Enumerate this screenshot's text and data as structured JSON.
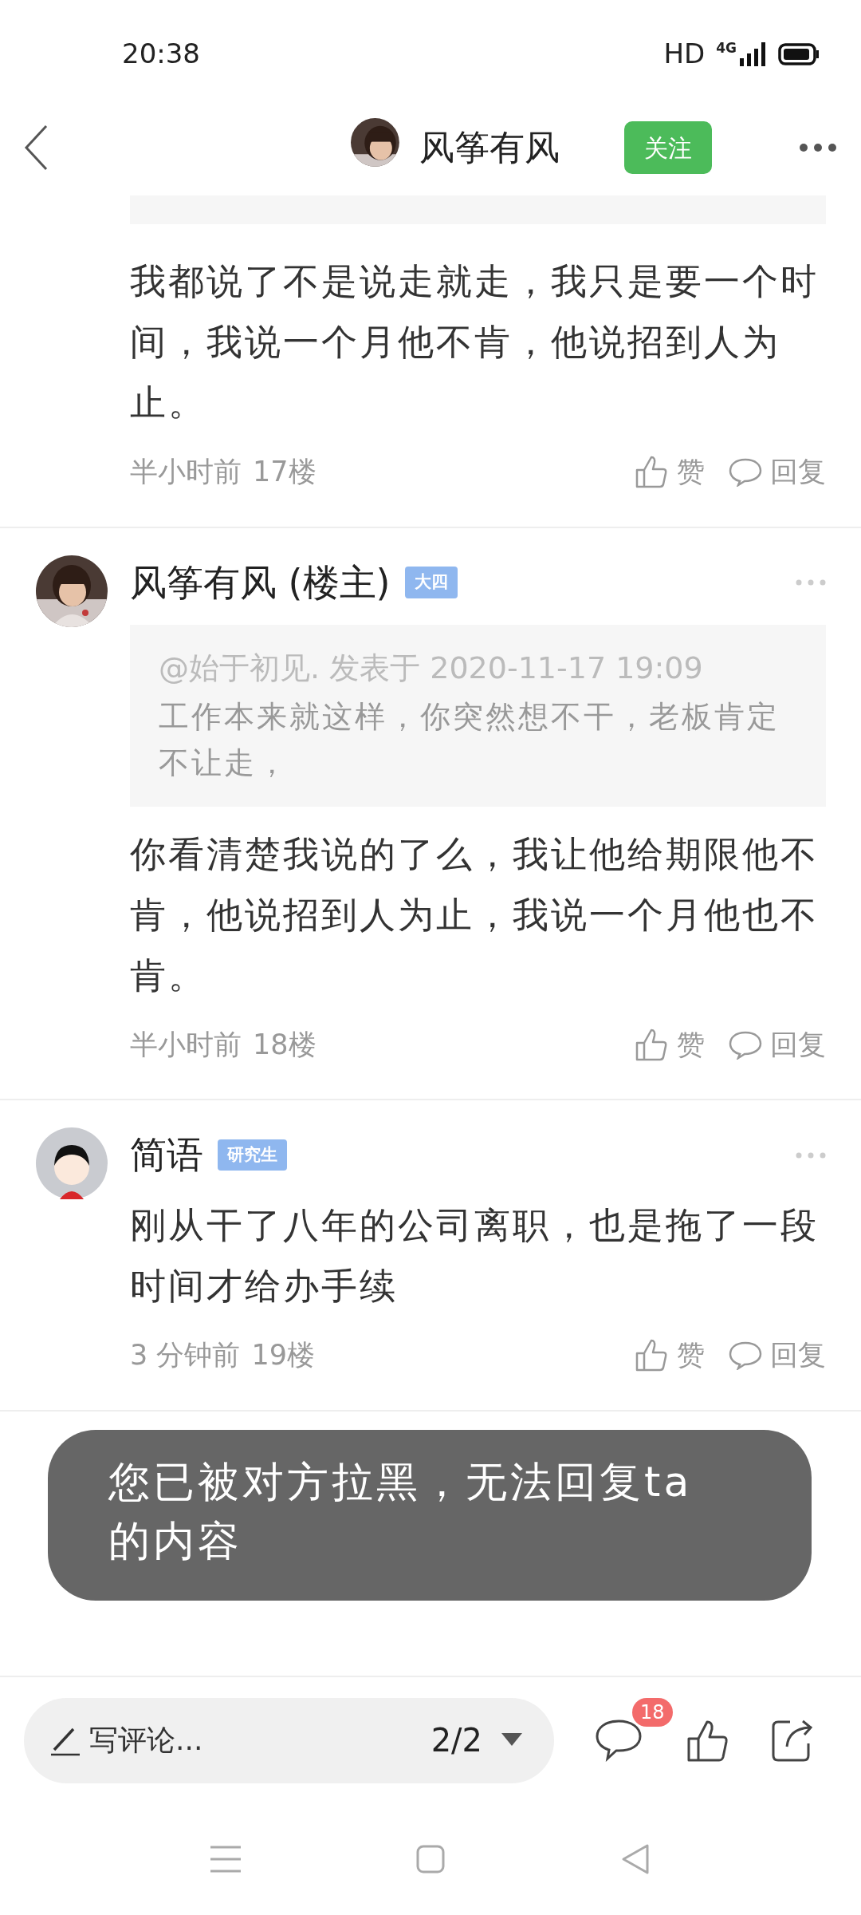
{
  "status_bar": {
    "time": "20:38",
    "hd": "HD",
    "network": "4G"
  },
  "header": {
    "title": "风筝有风",
    "follow_button": "关注"
  },
  "posts": [
    {
      "quote_cut_off": true,
      "body": "我都说了不是说走就走，我只是要一个时间，我说一个月他不肯，他说招到人为止。",
      "time": "半小时前",
      "floor": "17楼",
      "like": "赞",
      "reply": "回复"
    },
    {
      "author": {
        "name": "风筝有风 (楼主)"
      },
      "badge": "大四",
      "quote": {
        "mention": "@始于初见. 发表于 2020-11-17 19:09",
        "text": "工作本来就这样，你突然想不干，老板肯定不让走，"
      },
      "body": "你看清楚我说的了么，我让他给期限他不肯，他说招到人为止，我说一个月他也不肯。",
      "time": "半小时前",
      "floor": "18楼",
      "like": "赞",
      "reply": "回复"
    },
    {
      "author": {
        "name": "简语",
        "avatar": {
          "kind": "icon"
        }
      },
      "badge": "研究生",
      "body": "刚从干了八年的公司离职，也是拖了一段时间才给办手续",
      "time": "3 分钟前",
      "floor": "19楼",
      "like": "赞",
      "reply": "回复"
    }
  ],
  "toast": "您已被对方拉黑，无法回复ta的内容",
  "bottom_bar": {
    "placeholder": "写评论...",
    "page": "2/2",
    "comment_count": "18"
  }
}
